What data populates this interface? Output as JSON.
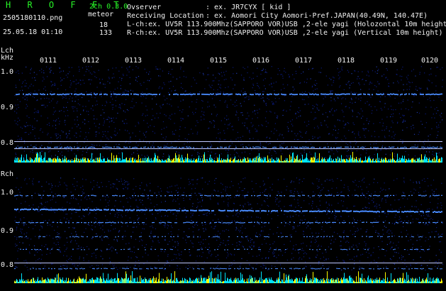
{
  "header": {
    "brand": "H R O F F T",
    "version": "2ch 0.3.0",
    "filename": "2505180110.png",
    "datetime": "25.05.18 01:10",
    "meteor_label": "meteor",
    "meteor_lch": "18",
    "meteor_rch": "133",
    "observer_label": "Ovserver",
    "observer_value": ": ex. JR7CYX [ kid ]",
    "location_label": "Receiving Location",
    "location_value": ": ex. Aomori City Aomori-Pref.JAPAN(40.49N, 140.47E)",
    "lch_info": "L-ch:ex. UV5R 113.900Mhz(SAPPORO VOR)USB ,2-ele yagi (Holozontal 10m height)",
    "rch_info": "R-ch:ex. UV5R 113.900Mhz(SAPPORO VOR)USB ,2-ele yagi (Vertical 10m height)"
  },
  "time_ticks": [
    "0111",
    "0112",
    "0113",
    "0114",
    "0115",
    "0116",
    "0117",
    "0118",
    "0119",
    "0120"
  ],
  "lch": {
    "label": "Lch",
    "unit": "kHz",
    "freq_ticks": [
      "1.0",
      "0.9",
      "0.8"
    ]
  },
  "rch": {
    "label": "Rch",
    "freq_ticks": [
      "1.0",
      "0.9",
      "0.8"
    ]
  },
  "colors": {
    "background": "#000000",
    "header_text": "#27f527",
    "axis_text": "#5ee0ff",
    "spectrum_noise": "#0b1a7a",
    "signal_line": "#4a8cff",
    "power_low": "#00e5ff",
    "power_high": "#ffff00"
  }
}
